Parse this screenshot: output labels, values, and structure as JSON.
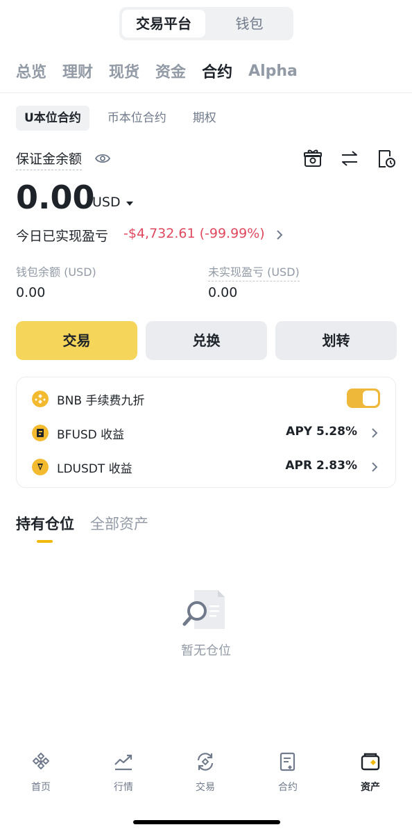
{
  "top_switch": {
    "exchange": "交易平台",
    "wallet": "钱包"
  },
  "tabs": [
    {
      "label": "总览",
      "active": false
    },
    {
      "label": "理财",
      "active": false
    },
    {
      "label": "现货",
      "active": false
    },
    {
      "label": "资金",
      "active": false
    },
    {
      "label": "合约",
      "active": true
    },
    {
      "label": "Alpha",
      "active": false
    }
  ],
  "subtabs": [
    {
      "label": "U本位合约",
      "active": true
    },
    {
      "label": "币本位合约",
      "active": false
    },
    {
      "label": "期权",
      "active": false
    }
  ],
  "balance": {
    "label": "保证金余额",
    "value": "0.00",
    "currency": "USD",
    "pnl_label": "今日已实现盈亏",
    "pnl_value": "-$4,732.61 (-99.99%)",
    "wallet_label": "钱包余额 (USD)",
    "wallet_value": "0.00",
    "unrealized_label": "未实现盈亏 (USD)",
    "unrealized_value": "0.00"
  },
  "actions": {
    "trade": "交易",
    "convert": "兑换",
    "transfer": "划转"
  },
  "promo": {
    "bnb_label": "BNB 手续费九折",
    "bnb_toggle_on": true,
    "bfusd_label": "BFUSD 收益",
    "bfusd_value": "APY 5.28%",
    "ldusdt_label": "LDUSDT 收益",
    "ldusdt_value": "APR 2.83%"
  },
  "holdings": {
    "positions_tab": "持有仓位",
    "assets_tab": "全部资产",
    "empty_text": "暂无仓位"
  },
  "bottom_nav": [
    {
      "label": "首页",
      "icon": "home-icon",
      "active": false
    },
    {
      "label": "行情",
      "icon": "markets-icon",
      "active": false
    },
    {
      "label": "交易",
      "icon": "trade-icon",
      "active": false
    },
    {
      "label": "合约",
      "icon": "futures-icon",
      "active": false
    },
    {
      "label": "资产",
      "icon": "assets-icon",
      "active": true
    }
  ],
  "colors": {
    "accent": "#F0B90B",
    "primary_button": "#F5D55A",
    "loss": "#E0485E"
  }
}
